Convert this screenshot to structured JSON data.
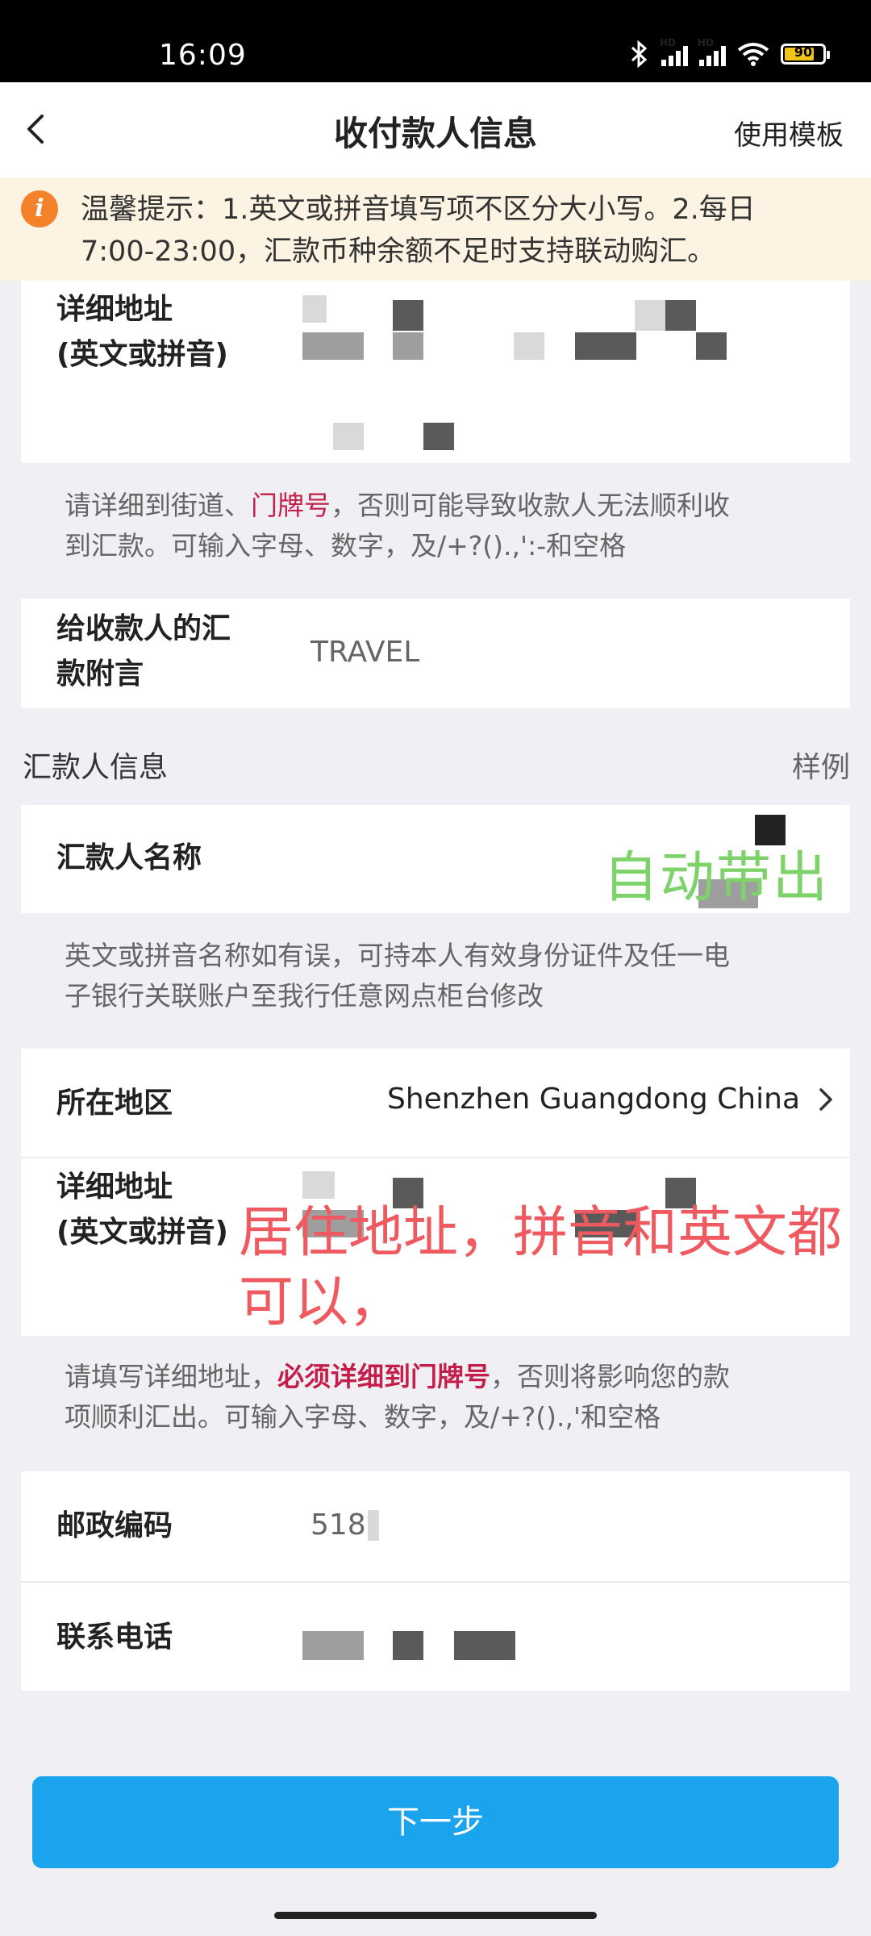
{
  "status_bar": {
    "time": "16:09",
    "battery": "90"
  },
  "nav": {
    "title": "收付款人信息",
    "right_action": "使用模板"
  },
  "notice": {
    "line1": "温馨提示：1.英文或拼音填写项不区分大小写。2.每日",
    "line2": "7:00-23:00，汇款币种余额不足时支持联动购汇。"
  },
  "payee": {
    "address_label_1": "详细地址",
    "address_label_2": "(英文或拼音)",
    "address_hint_a": "请详细到街道、",
    "address_hint_highlight": "门牌号",
    "address_hint_b": "，否则可能导致收款人无法顺利收",
    "address_hint_line2": "到汇款。可输入字母、数字，及/+?().,':-和空格",
    "memo_label_1": "给收款人的汇",
    "memo_label_2": "款附言",
    "memo_value": "TRAVEL"
  },
  "remitter": {
    "section_title": "汇款人信息",
    "section_example": "样例",
    "name_label": "汇款人名称",
    "name_hint_line1": "英文或拼音名称如有误，可持本人有效身份证件及任一电",
    "name_hint_line2": "子银行关联账户至我行任意网点柜台修改",
    "region_label": "所在地区",
    "region_value": "Shenzhen Guangdong China",
    "address_label_1": "详细地址",
    "address_label_2": "(英文或拼音)",
    "address_hint_a": "请填写详细地址，",
    "address_hint_highlight": "必须详细到门牌号",
    "address_hint_b": "，否则将影响您的款",
    "address_hint_line2": "项顺利汇出。可输入字母、数字，及/+?().,'和空格",
    "postcode_label": "邮政编码",
    "postcode_value": "518",
    "phone_label": "联系电话"
  },
  "annotations": {
    "green": "自动带出",
    "red_line1": "居住地址，拼音和英文都",
    "red_line2": "可以，"
  },
  "footer": {
    "next_button": "下一步"
  }
}
